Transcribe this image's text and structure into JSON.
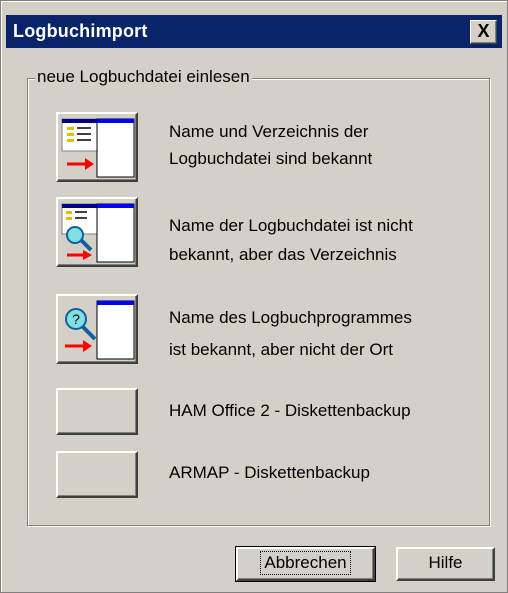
{
  "window": {
    "title": "Logbuchimport",
    "close_label": "X"
  },
  "group": {
    "legend": "neue Logbuchdatei einlesen",
    "options": [
      {
        "icon": "known-file-icon",
        "line1": "Name und Verzeichnis der",
        "line2": "Logbuchdatei sind bekannt"
      },
      {
        "icon": "search-folder-icon",
        "line1": "Name der Logbuchdatei ist nicht",
        "line2": "bekannt, aber das Verzeichnis"
      },
      {
        "icon": "search-program-icon",
        "line1": "Name des Logbuchprogrammes",
        "line2": "ist bekannt, aber nicht der Ort"
      },
      {
        "icon": "",
        "line1": "HAM Office 2 - Diskettenbackup"
      },
      {
        "icon": "",
        "line1": "ARMAP - Diskettenbackup"
      }
    ]
  },
  "buttons": {
    "cancel": "Abbrechen",
    "help": "Hilfe"
  }
}
